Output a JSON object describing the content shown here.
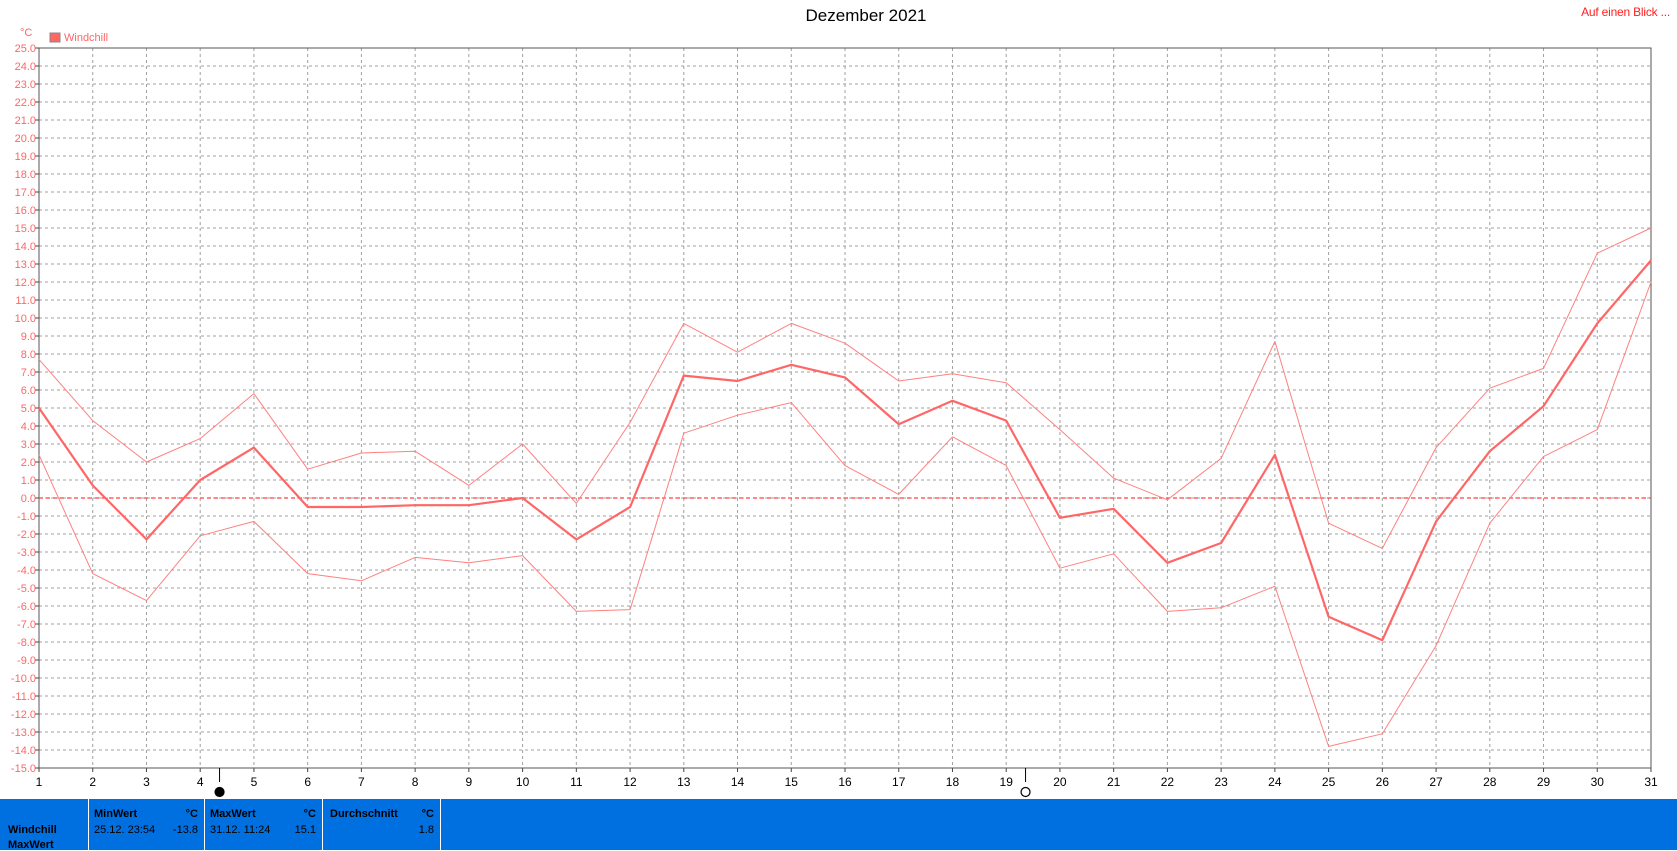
{
  "header": {
    "title": "Dezember 2021",
    "link_label": "Auf einen Blick ..."
  },
  "legend": {
    "label": "Windchill",
    "unit": "°C",
    "color": "#ff6666"
  },
  "moon": {
    "full_moon_day": "4",
    "new_moon_day": "19",
    "full_icon": "full-moon-icon",
    "new_icon": "new-moon-icon"
  },
  "chart_data": {
    "type": "line",
    "title": "Dezember 2021",
    "ylabel": "°C",
    "xlabel": "",
    "ylim": [
      -15,
      25
    ],
    "y_tick_step": 1,
    "x": [
      1,
      2,
      3,
      4,
      5,
      6,
      7,
      8,
      9,
      10,
      11,
      12,
      13,
      14,
      15,
      16,
      17,
      18,
      19,
      20,
      21,
      22,
      23,
      24,
      25,
      26,
      27,
      28,
      29,
      30,
      31
    ],
    "grid": true,
    "legend_position": "top-left",
    "zero_line_color": "#ff4040",
    "series": [
      {
        "name": "Windchill",
        "role": "average",
        "color": "#ff6666",
        "values": [
          5.0,
          0.7,
          -2.3,
          1.0,
          2.8,
          -0.5,
          -0.5,
          -0.4,
          -0.4,
          0.0,
          -2.3,
          -0.5,
          6.8,
          6.5,
          7.4,
          6.7,
          4.1,
          5.4,
          4.3,
          -1.1,
          -0.6,
          -3.6,
          -2.5,
          2.4,
          -6.6,
          -7.9,
          -1.3,
          2.6,
          5.1,
          9.7,
          13.2
        ]
      },
      {
        "role": "max",
        "color": "#ff8080",
        "values": [
          7.7,
          4.3,
          2.0,
          3.3,
          5.8,
          1.6,
          2.5,
          2.6,
          0.7,
          3.0,
          -0.3,
          4.2,
          9.7,
          8.1,
          9.7,
          8.6,
          6.5,
          6.9,
          6.4,
          3.8,
          1.1,
          -0.1,
          2.2,
          8.7,
          -1.4,
          -2.8,
          2.8,
          6.1,
          7.2,
          13.6,
          15.0
        ]
      },
      {
        "role": "min",
        "color": "#ff8080",
        "values": [
          2.4,
          -4.2,
          -5.7,
          -2.1,
          -1.3,
          -4.2,
          -4.6,
          -3.3,
          -3.6,
          -3.2,
          -6.3,
          -6.2,
          3.6,
          4.6,
          5.3,
          1.8,
          0.2,
          3.4,
          1.8,
          -3.9,
          -3.1,
          -6.3,
          -6.1,
          -4.9,
          -13.8,
          -13.1,
          -8.2,
          -1.4,
          2.3,
          3.8,
          12.0
        ]
      }
    ]
  },
  "stats": {
    "row_label_1": "Windchill",
    "row_label_2": "MaxWert",
    "min_header": "MinWert",
    "min_unit": "°C",
    "min_time": "25.12.  23:54",
    "min_value": "-13.8",
    "max_header": "MaxWert",
    "max_unit": "°C",
    "max_time": "31.12.  11:24",
    "max_value": "15.1",
    "avg_header": "Durchschnitt",
    "avg_unit": "°C",
    "avg_value": "1.8",
    "bar_color": "#0070e0"
  }
}
